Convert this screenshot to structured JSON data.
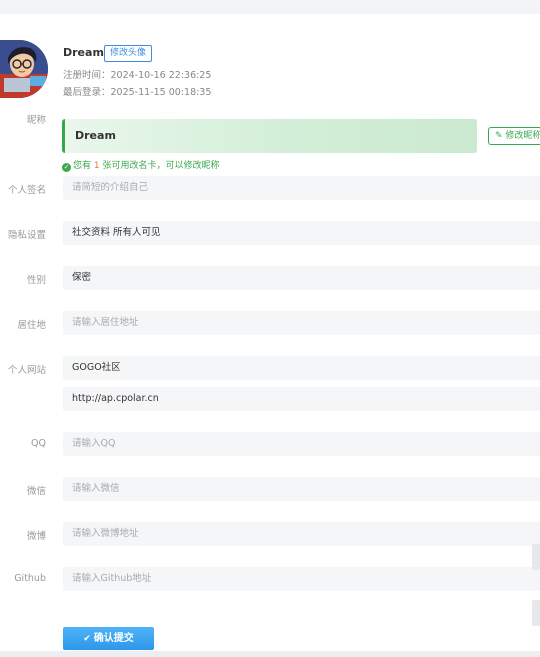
{
  "profile": {
    "name": "Dream",
    "edit_avatar": "修改头像",
    "register_time": "注册时间：2024-10-16 22:36:25",
    "last_login": "最后登录：2025-11-15 00:18:35"
  },
  "nickname": {
    "label": "昵称",
    "value": "Dream",
    "edit_button": "修改昵称",
    "hint_prefix": "您有 ",
    "hint_count": "1",
    "hint_suffix": " 张可用改名卡，可以修改昵称"
  },
  "fields": {
    "signature": {
      "label": "个人签名",
      "placeholder": "请简短的介绍自己"
    },
    "privacy": {
      "label": "隐私设置",
      "value": "社交资料 所有人可见"
    },
    "gender": {
      "label": "性别",
      "value": "保密"
    },
    "residence": {
      "label": "居住地",
      "placeholder": "请输入居住地址"
    },
    "website": {
      "label": "个人网站",
      "name_value": "GOGO社区",
      "url_value": "http://ap.cpolar.cn"
    },
    "qq": {
      "label": "QQ",
      "placeholder": "请输入QQ"
    },
    "wechat": {
      "label": "微信",
      "placeholder": "请输入微信"
    },
    "weibo": {
      "label": "微博",
      "placeholder": "请输入微博地址"
    },
    "github": {
      "label": "Github",
      "placeholder": "请输入Github地址"
    }
  },
  "submit": {
    "label": "确认提交"
  },
  "icons": {
    "edit": "edit-icon",
    "check": "check-circle-icon",
    "submit": "check-icon"
  }
}
